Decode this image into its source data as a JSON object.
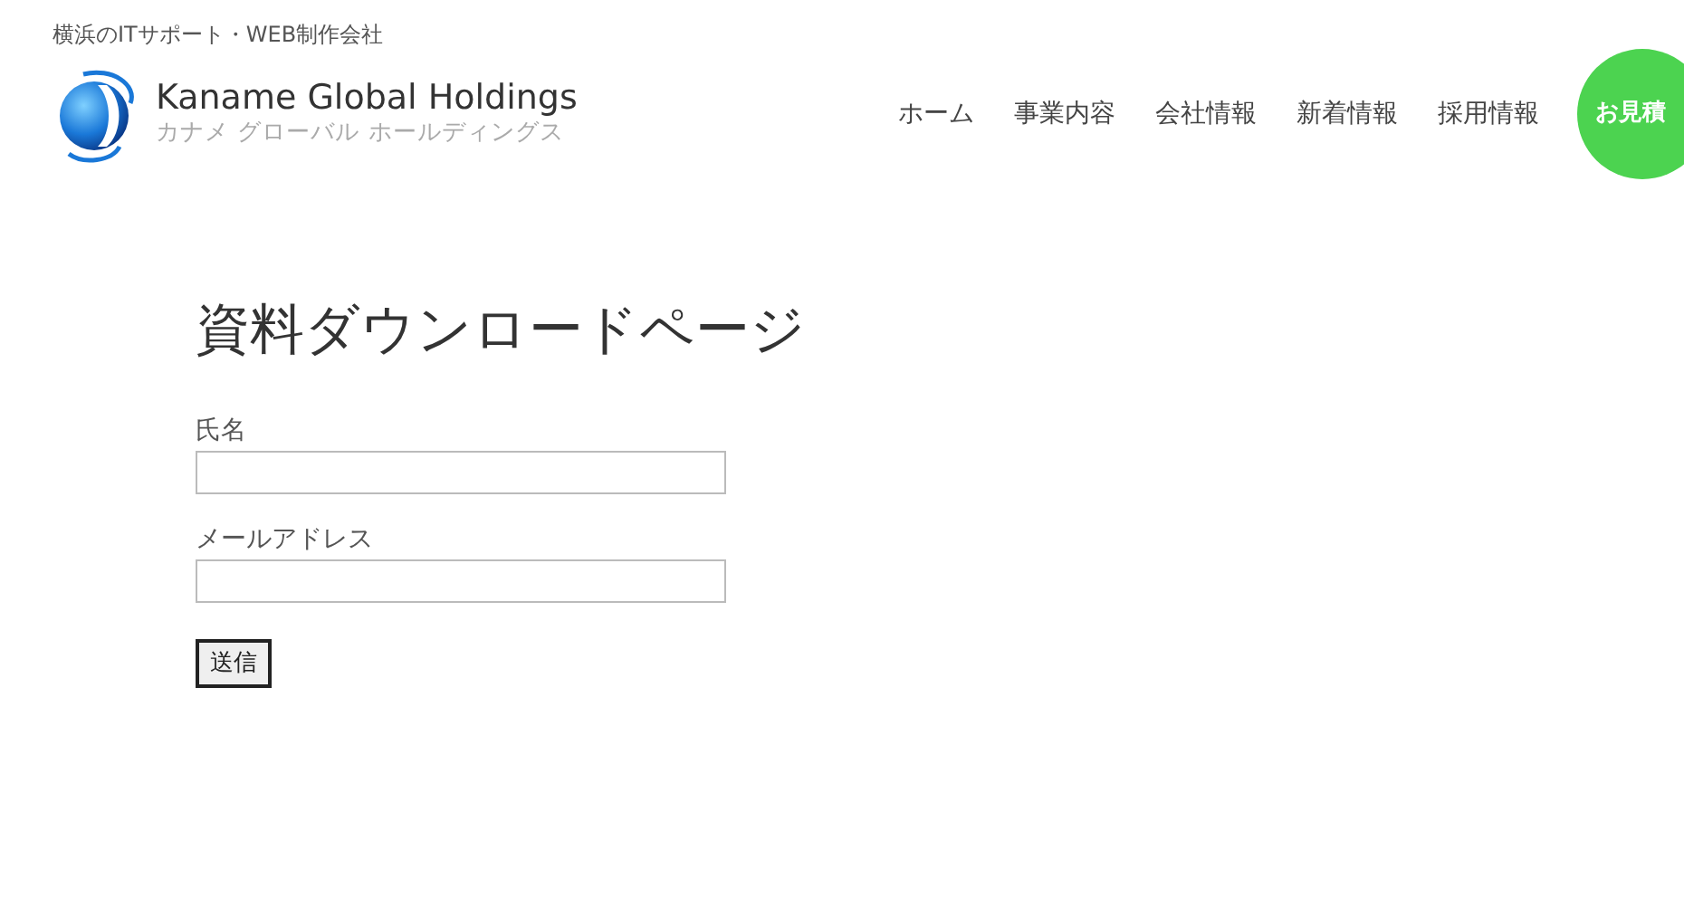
{
  "header": {
    "tagline": "横浜のITサポート・WEB制作会社",
    "logo": {
      "name": "Kaname Global Holdings",
      "kana": "カナメ グローバル ホールディングス"
    },
    "nav": [
      {
        "label": "ホーム"
      },
      {
        "label": "事業内容"
      },
      {
        "label": "会社情報"
      },
      {
        "label": "新着情報"
      },
      {
        "label": "採用情報"
      }
    ],
    "cta": "お見積"
  },
  "form": {
    "title": "資料ダウンロードページ",
    "fields": [
      {
        "label": "氏名"
      },
      {
        "label": "メールアドレス"
      }
    ],
    "submit": "送信"
  }
}
